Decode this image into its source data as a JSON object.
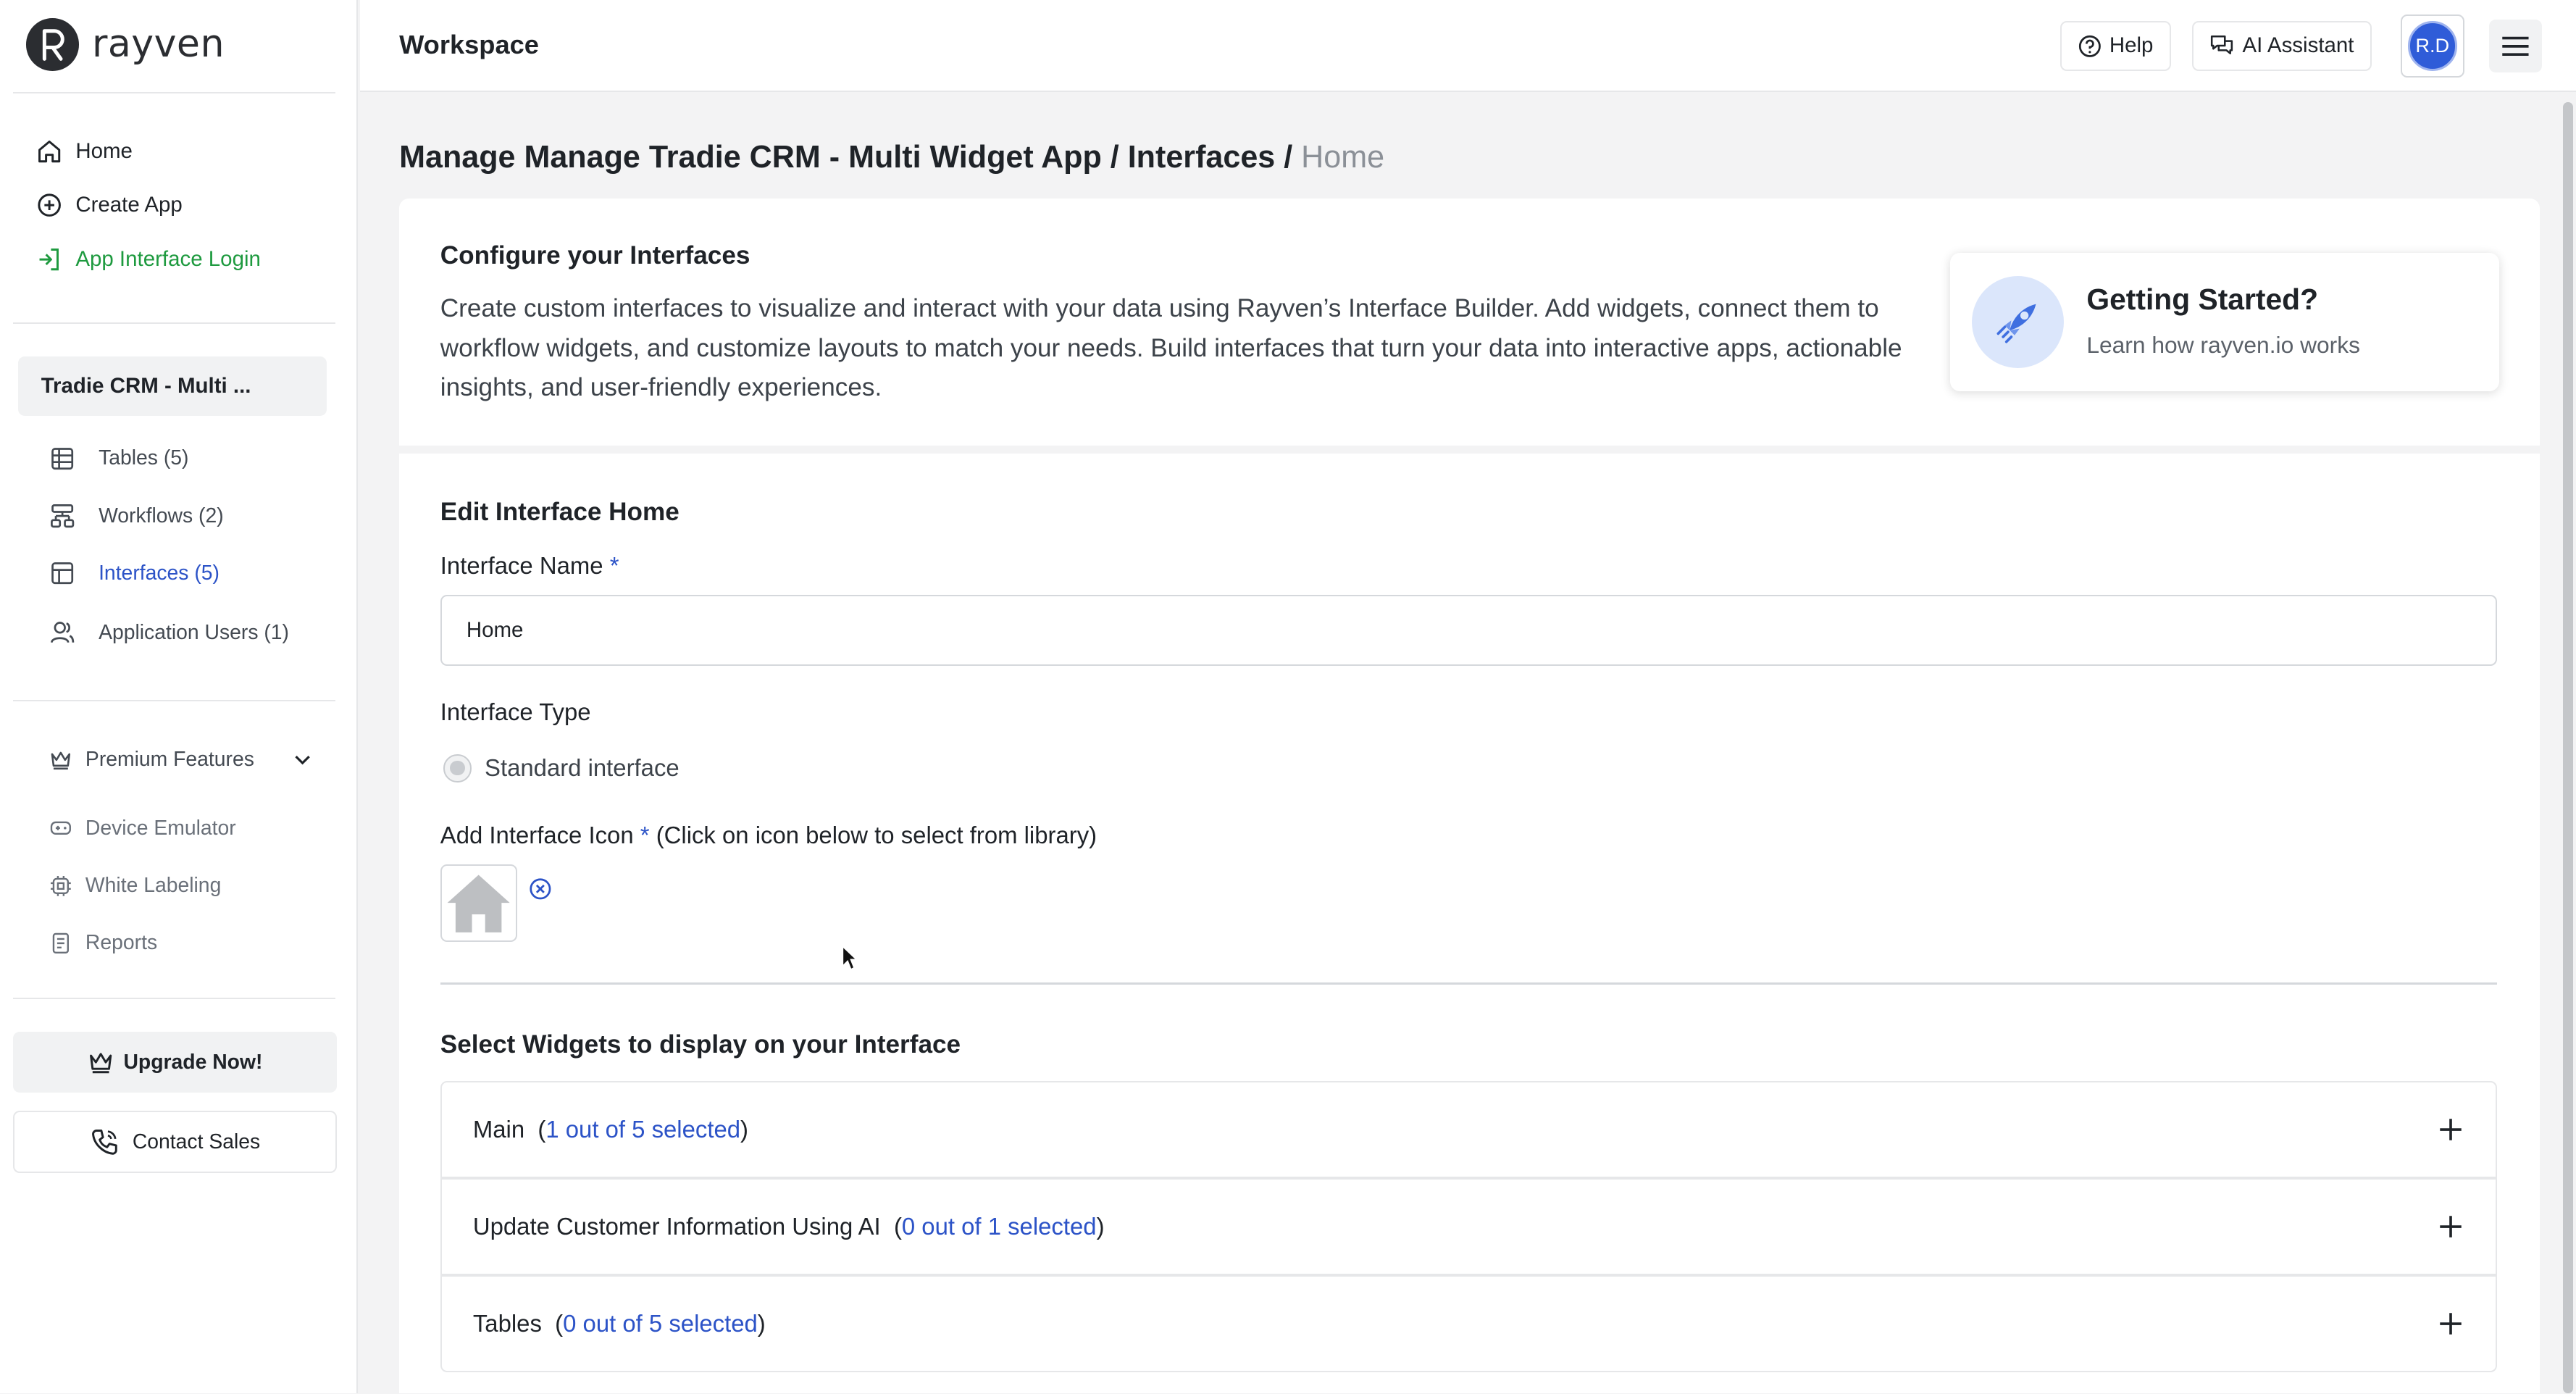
{
  "brand": {
    "name": "rayven"
  },
  "sidebar": {
    "nav": [
      {
        "label": "Home",
        "icon": "home-icon"
      },
      {
        "label": "Create App",
        "icon": "plus-circle-icon"
      },
      {
        "label": "App Interface Login",
        "icon": "login-icon"
      }
    ],
    "app_name": "Tradie CRM - Multi ...",
    "app_items": [
      {
        "label": "Tables (5)",
        "icon": "table-icon"
      },
      {
        "label": "Workflows (2)",
        "icon": "workflow-icon"
      },
      {
        "label": "Interfaces (5)",
        "icon": "interface-icon"
      },
      {
        "label": "Application Users (1)",
        "icon": "users-icon"
      }
    ],
    "premium_label": "Premium Features",
    "premium_items": [
      {
        "label": "Device Emulator",
        "icon": "gamepad-icon"
      },
      {
        "label": "White Labeling",
        "icon": "chip-icon"
      },
      {
        "label": "Reports",
        "icon": "report-icon"
      }
    ],
    "upgrade_label": "Upgrade Now!",
    "contact_label": "Contact Sales"
  },
  "topbar": {
    "title": "Workspace",
    "help_label": "Help",
    "ai_label": "AI Assistant",
    "avatar_initials": "R.D"
  },
  "breadcrumb": {
    "path": "Manage Manage Tradie CRM - Multi Widget App / Interfaces / ",
    "current": "Home"
  },
  "intro": {
    "title": "Configure your Interfaces",
    "description": "Create custom interfaces to visualize and interact with your data using Rayven’s Interface Builder. Add widgets, connect them to workflow widgets, and customize layouts to match your needs. Build interfaces that turn your data into interactive apps, actionable insights, and user-friendly experiences.",
    "getting_started_title": "Getting Started?",
    "getting_started_sub": "Learn how rayven.io works"
  },
  "form": {
    "section_title": "Edit Interface Home",
    "name_label": "Interface Name",
    "required_mark": "*",
    "name_value": "Home",
    "type_label": "Interface Type",
    "type_option": "Standard interface",
    "icon_label": "Add Interface Icon",
    "icon_hint": " (Click on icon below to select from library)",
    "widgets_title": "Select Widgets to display on your Interface",
    "widget_groups": [
      {
        "name": "Main",
        "selected": "1 out of 5 selected"
      },
      {
        "name": "Update Customer Information Using AI",
        "selected": "0 out of 1 selected"
      },
      {
        "name": "Tables",
        "selected": "0 out of 5 selected"
      }
    ]
  },
  "colors": {
    "accent_green": "#1e9a3f",
    "accent_blue": "#2c53c7",
    "avatar_blue": "#2f5cd8"
  }
}
